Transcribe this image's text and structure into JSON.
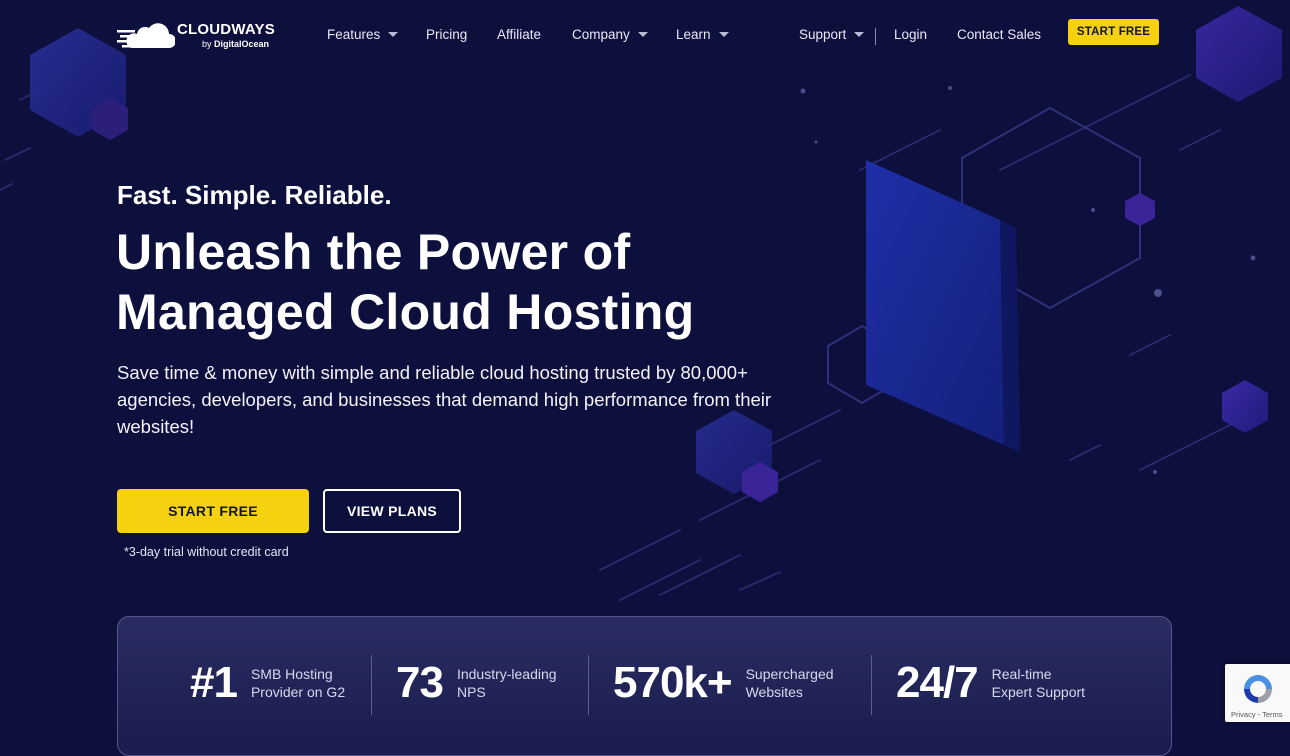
{
  "brand": {
    "name": "CLOUDWAYS",
    "by": "by",
    "parent": "DigitalOcean"
  },
  "nav": {
    "features": "Features",
    "pricing": "Pricing",
    "affiliate": "Affiliate",
    "company": "Company",
    "learn": "Learn",
    "support": "Support",
    "login": "Login",
    "contact_sales": "Contact Sales",
    "start_free": "START FREE"
  },
  "hero": {
    "kicker": "Fast. Simple. Reliable.",
    "headline_line1": "Unleash the Power of",
    "headline_line2": "Managed Cloud Hosting",
    "subtext": "Save time & money with simple and reliable cloud hosting trusted by 80,000+ agencies, developers, and businesses that demand high performance from their websites!",
    "primary_cta": "START FREE",
    "secondary_cta": "VIEW PLANS",
    "trial_note": "*3-day trial without credit card"
  },
  "stats": [
    {
      "value": "#1",
      "label_line1": "SMB Hosting",
      "label_line2": "Provider on G2"
    },
    {
      "value": "73",
      "label_line1": "Industry-leading",
      "label_line2": "NPS"
    },
    {
      "value": "570k+",
      "label_line1": "Supercharged",
      "label_line2": "Websites"
    },
    {
      "value": "24/7",
      "label_line1": "Real-time",
      "label_line2": "Expert Support"
    }
  ],
  "recaptcha": {
    "links": "Privacy - Terms"
  },
  "colors": {
    "background": "#0d0f3d",
    "accent": "#f6d110",
    "text": "#ffffff"
  }
}
